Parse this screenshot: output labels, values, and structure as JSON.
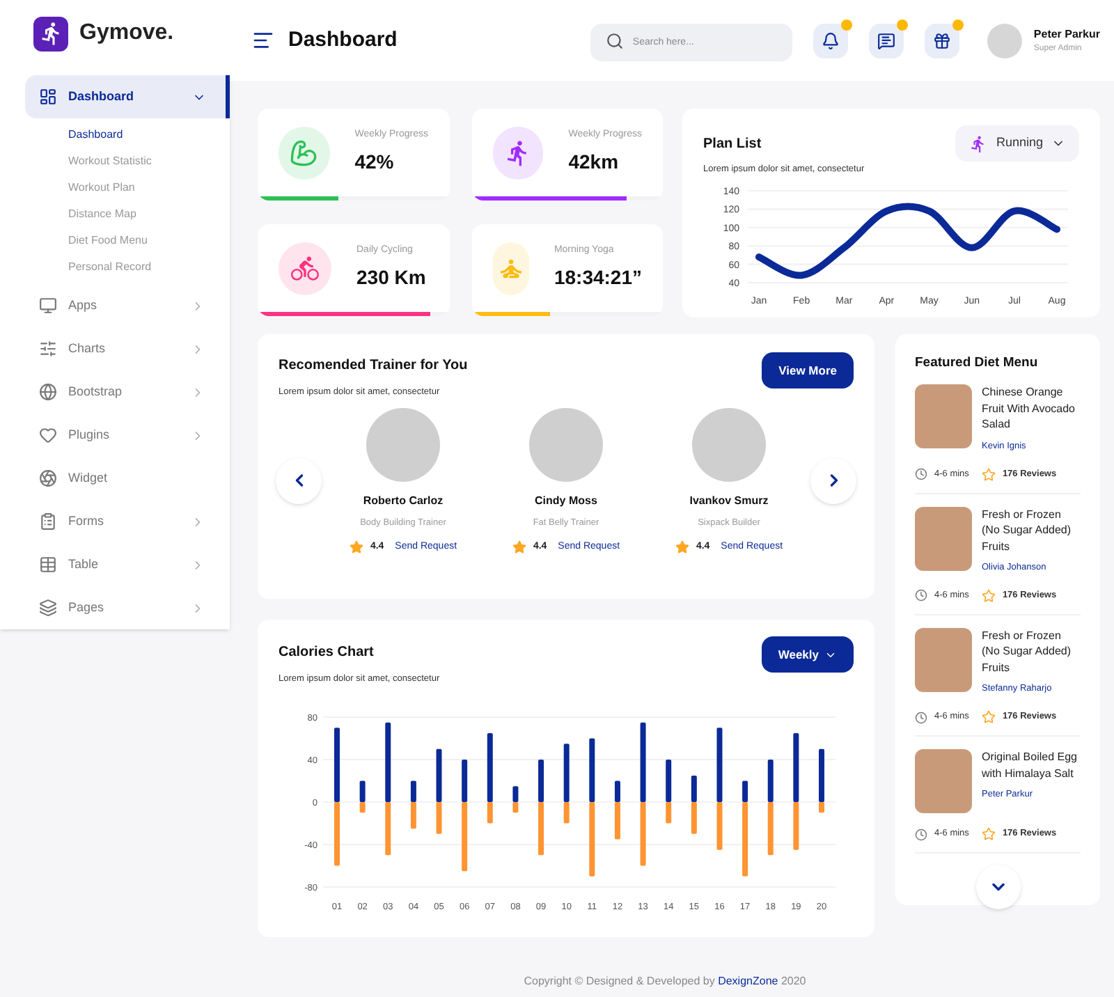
{
  "brand": {
    "name": "Gymove."
  },
  "header": {
    "title": "Dashboard",
    "search": {
      "placeholder": "Search here..."
    },
    "icons": [
      {
        "kind": "bell",
        "dot": true
      },
      {
        "kind": "chat",
        "dot": true
      },
      {
        "kind": "gift",
        "dot": true
      }
    ],
    "user": {
      "name": "Peter Parkur",
      "role": "Super Admin"
    }
  },
  "sidebar": {
    "items": [
      {
        "label": "Dashboard",
        "expandable": true,
        "expanded": true,
        "selected": true,
        "children": [
          {
            "label": "Dashboard",
            "selected": true
          },
          {
            "label": "Workout Statistic",
            "selected": false
          },
          {
            "label": "Workout Plan",
            "selected": false
          },
          {
            "label": "Distance Map",
            "selected": false
          },
          {
            "label": "Diet Food Menu",
            "selected": false
          },
          {
            "label": "Personal Record",
            "selected": false
          }
        ]
      },
      {
        "label": "Apps",
        "expandable": true,
        "expanded": false,
        "selected": false
      },
      {
        "label": "Charts",
        "expandable": true,
        "expanded": false,
        "selected": false
      },
      {
        "label": "Bootstrap",
        "expandable": true,
        "expanded": false,
        "selected": false
      },
      {
        "label": "Plugins",
        "expandable": true,
        "expanded": false,
        "selected": false
      },
      {
        "label": "Widget",
        "expandable": false,
        "selected": false
      },
      {
        "label": "Forms",
        "expandable": true,
        "expanded": false,
        "selected": false
      },
      {
        "label": "Table",
        "expandable": true,
        "expanded": false,
        "selected": false
      },
      {
        "label": "Pages",
        "expandable": true,
        "expanded": false,
        "selected": false
      }
    ]
  },
  "stats": [
    {
      "label": "Weekly Progress",
      "value": "42%",
      "color": "#2bc155",
      "level": 0.42
    },
    {
      "label": "Weekly Progress",
      "value": "42km",
      "color": "#a02cfa",
      "level": 0.81
    },
    {
      "label": "Daily Cycling",
      "value": "230 Km",
      "color": "#ff3282",
      "level": 0.9
    },
    {
      "label": "Morning Yoga",
      "value": "18:34:21”",
      "color": "#ffbc11",
      "level": 0.41
    }
  ],
  "plan_list": {
    "title": "Plan List",
    "subtitle": "Lorem ipsum dolor sit amet, consectetur",
    "filter": "Running",
    "chart_data": {
      "type": "line",
      "categories": [
        "Jan",
        "Feb",
        "Mar",
        "Apr",
        "May",
        "Jun",
        "Jul",
        "Aug"
      ],
      "series": [
        {
          "color": "#0b2a97",
          "values": [
            68,
            48,
            78,
            118,
            118,
            78,
            118,
            98
          ]
        }
      ],
      "grid": true,
      "ylim": [
        40,
        140
      ],
      "yticks": [
        40,
        60,
        80,
        100,
        120,
        140
      ]
    }
  },
  "trainers": {
    "title": "Recomended Trainer for You",
    "subtitle": "Lorem ipsum dolor sit amet, consectetur",
    "button": "View More",
    "items": [
      {
        "name": "Roberto Carloz",
        "role": "Body Building Trainer",
        "rating": "4.4",
        "action": "Send Request"
      },
      {
        "name": "Cindy Moss",
        "role": "Fat Belly Trainer",
        "rating": "4.4",
        "action": "Send Request"
      },
      {
        "name": "Ivankov Smurz",
        "role": "Sixpack Builder",
        "rating": "4.4",
        "action": "Send Request"
      }
    ]
  },
  "diet_menu": {
    "title": "Featured Diet Menu",
    "items": [
      {
        "name": "Chinese Orange Fruit With Avocado Salad",
        "author": "Kevin Ignis",
        "time": "4-6 mins",
        "reviews": "176 Reviews"
      },
      {
        "name": "Fresh or Frozen (No Sugar Added) Fruits",
        "author": "Olivia Johanson",
        "time": "4-6 mins",
        "reviews": "176 Reviews"
      },
      {
        "name": "Fresh or Frozen (No Sugar Added) Fruits",
        "author": "Stefanny Raharjo",
        "time": "4-6 mins",
        "reviews": "176 Reviews"
      },
      {
        "name": "Original Boiled Egg with Himalaya Salt",
        "author": "Peter Parkur",
        "time": "4-6 mins",
        "reviews": "176 Reviews"
      }
    ]
  },
  "calories": {
    "title": "Calories Chart",
    "subtitle": "Lorem ipsum dolor sit amet, consectetur",
    "filter": "Weekly",
    "chart_data": {
      "type": "bar",
      "categories": [
        "01",
        "02",
        "03",
        "04",
        "05",
        "06",
        "07",
        "08",
        "09",
        "10",
        "11",
        "12",
        "13",
        "14",
        "15",
        "16",
        "17",
        "18",
        "19",
        "20"
      ],
      "series": [
        {
          "color": "#0b2a97",
          "values": [
            70,
            20,
            75,
            20,
            50,
            40,
            65,
            15,
            40,
            55,
            60,
            20,
            75,
            40,
            25,
            70,
            20,
            40,
            65,
            50
          ]
        },
        {
          "color": "#ff9432",
          "values": [
            -60,
            -10,
            -50,
            -25,
            -30,
            -65,
            -20,
            -10,
            -50,
            -20,
            -70,
            -35,
            -60,
            -20,
            -30,
            -45,
            -70,
            -50,
            -45,
            -10
          ]
        }
      ],
      "stacked": true,
      "grid": true,
      "ylim": [
        -80,
        80
      ],
      "yticks": [
        -80,
        -40,
        0,
        40,
        80
      ]
    }
  },
  "footer": {
    "text": "Copyright © Designed & Developed by",
    "link": "DexignZone",
    "year": "2020"
  }
}
